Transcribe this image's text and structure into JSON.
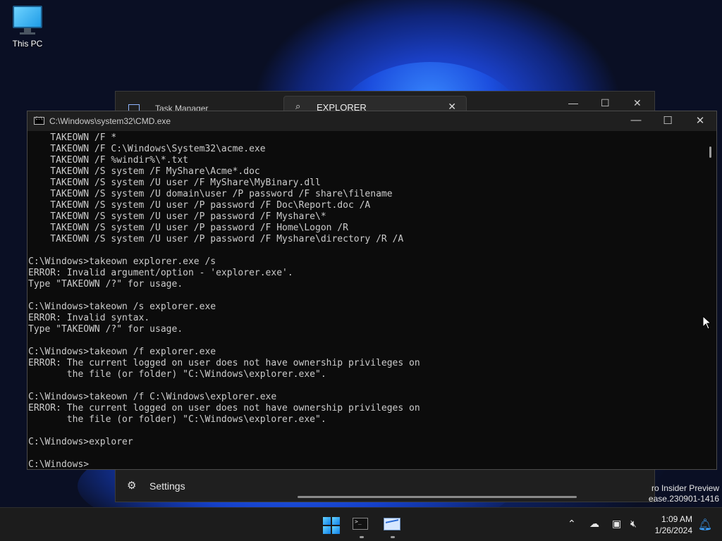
{
  "desktop": {
    "icons": [
      {
        "label": "This PC",
        "icon": "monitor-icon"
      }
    ]
  },
  "task_manager": {
    "title": "Task Manager",
    "search_value": "EXPLORER",
    "bottom_item": "Settings"
  },
  "cmd": {
    "title": "C:\\Windows\\system32\\CMD.exe",
    "lines": [
      "    TAKEOWN /F *",
      "    TAKEOWN /F C:\\Windows\\System32\\acme.exe",
      "    TAKEOWN /F %windir%\\*.txt",
      "    TAKEOWN /S system /F MyShare\\Acme*.doc",
      "    TAKEOWN /S system /U user /F MyShare\\MyBinary.dll",
      "    TAKEOWN /S system /U domain\\user /P password /F share\\filename",
      "    TAKEOWN /S system /U user /P password /F Doc\\Report.doc /A",
      "    TAKEOWN /S system /U user /P password /F Myshare\\*",
      "    TAKEOWN /S system /U user /P password /F Home\\Logon /R",
      "    TAKEOWN /S system /U user /P password /F Myshare\\directory /R /A",
      "",
      "C:\\Windows>takeown explorer.exe /s",
      "ERROR: Invalid argument/option - 'explorer.exe'.",
      "Type \"TAKEOWN /?\" for usage.",
      "",
      "C:\\Windows>takeown /s explorer.exe",
      "ERROR: Invalid syntax.",
      "Type \"TAKEOWN /?\" for usage.",
      "",
      "C:\\Windows>takeown /f explorer.exe",
      "ERROR: The current logged on user does not have ownership privileges on",
      "       the file (or folder) \"C:\\Windows\\explorer.exe\".",
      "",
      "C:\\Windows>takeown /f C:\\Windows\\explorer.exe",
      "ERROR: The current logged on user does not have ownership privileges on",
      "       the file (or folder) \"C:\\Windows\\explorer.exe\".",
      "",
      "C:\\Windows>explorer",
      "",
      "C:\\Windows>"
    ]
  },
  "watermark": {
    "line1": "ro Insider Preview",
    "line2": "ease.230901-1416"
  },
  "taskbar": {
    "clock_time": "1:09 AM",
    "clock_date": "1/26/2024",
    "items": [
      "start-button",
      "terminal-app",
      "task-manager-app"
    ]
  },
  "colors": {
    "terminal_bg": "#0c0c0c",
    "terminal_fg": "#cccccc",
    "accent": "#3aa0ff"
  }
}
